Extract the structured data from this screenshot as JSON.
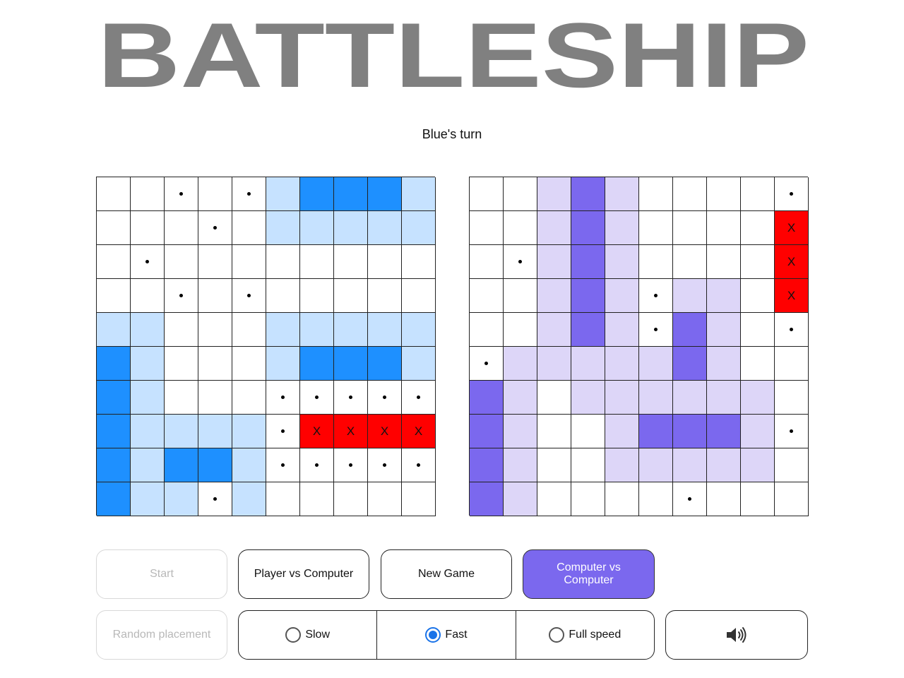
{
  "title": "BATTLESHIP",
  "status": "Blue's turn",
  "colors": {
    "blue_ship": "#1e90ff",
    "blue_zone": "#c6e2ff",
    "purple_ship": "#7b68ee",
    "purple_zone": "#ddd6f8",
    "hit": "#ff0000",
    "title_gray": "#808080",
    "active_button": "#7b68ee",
    "radio_checked": "#1a73e8"
  },
  "boards": {
    "blue": [
      "..o.oZSSSZ",
      "...o.ZZZZZ",
      ".o........",
      "..o.o.....",
      "ZZ...ZZZZZ",
      "SZ...ZSSSZ",
      "SZ...ooooo",
      "SZZZZoXXXX",
      "SZSSZooooo",
      "SZZoZ....."
    ],
    "purple": [
      "..zPz....oo",
      "..zPz....oX",
      ".ozPz....oX",
      "..zPzozz.oX",
      "..zPzoPz.oo",
      "ozzzzzPz..",
      "Pz.zzzzzz.",
      "Pz..zPPPzo",
      "Pz..zzzzz.",
      "Pz....o..."
    ]
  },
  "hit_mark": "X",
  "buttons": {
    "start": "Start",
    "pvc": "Player vs Computer",
    "new_game": "New Game",
    "cvc": "Computer vs Computer",
    "random_placement": "Random placement"
  },
  "speed": {
    "options": [
      "Slow",
      "Fast",
      "Full speed"
    ],
    "selected": "Fast"
  },
  "sound_icon": "speaker-volume-icon"
}
